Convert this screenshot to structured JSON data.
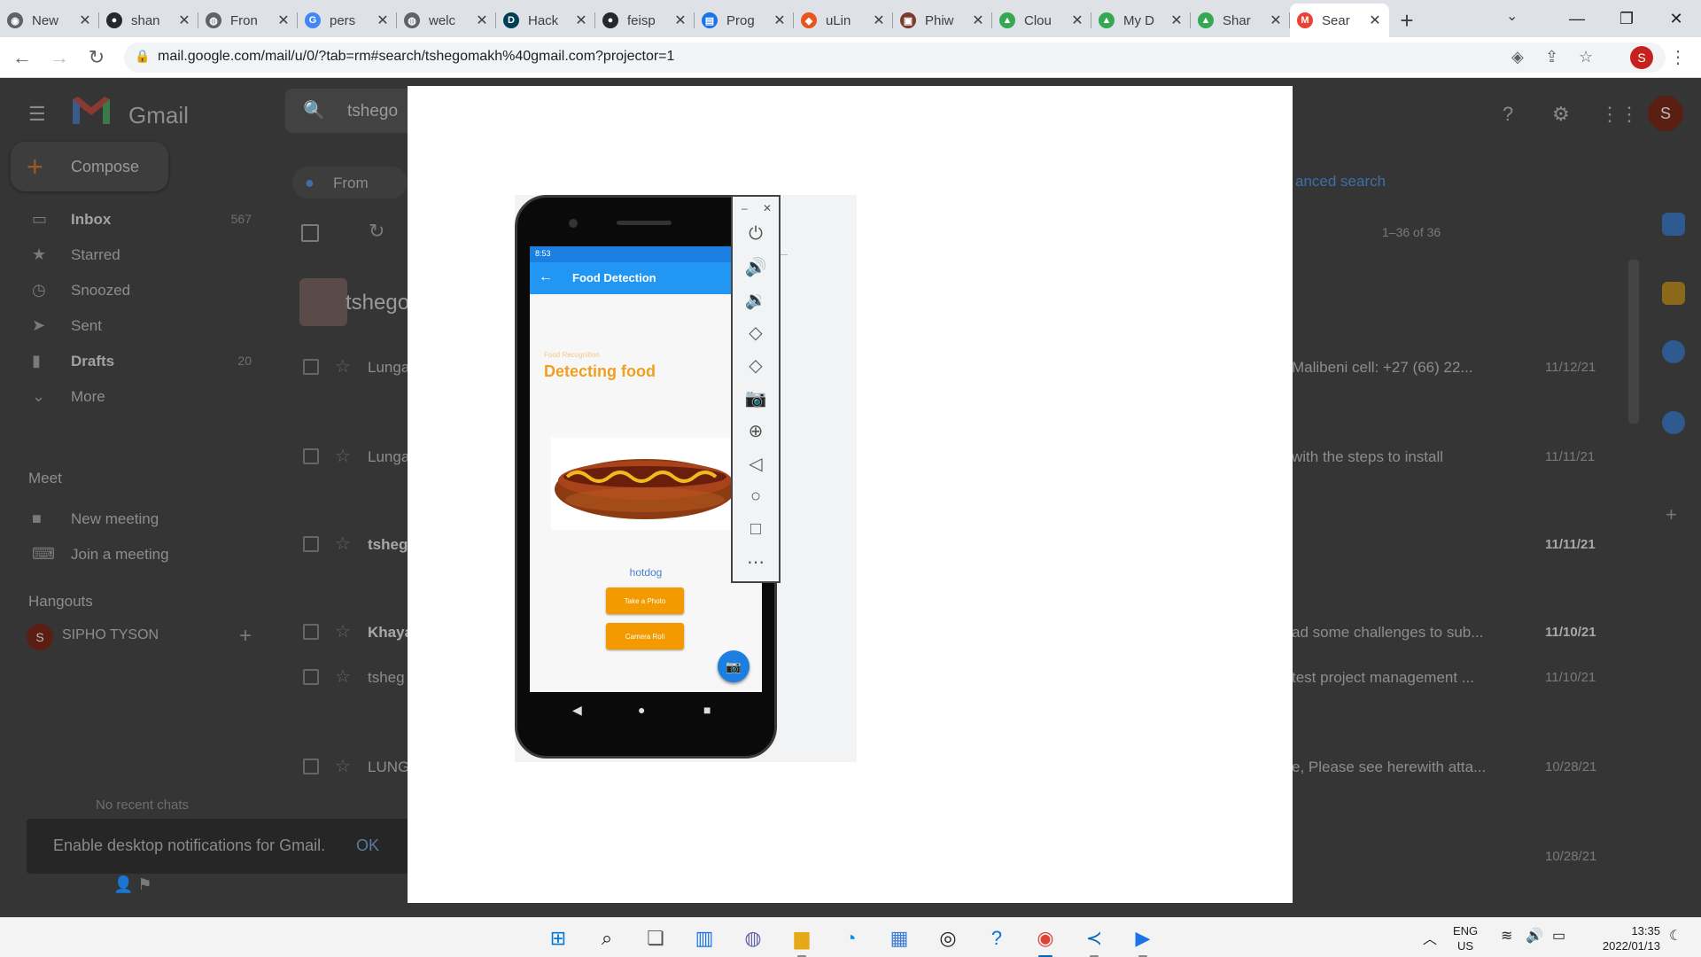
{
  "browser": {
    "tabs": [
      {
        "label": "New",
        "favicon": "chrome-icon",
        "color": "#5f6368"
      },
      {
        "label": "shan",
        "favicon": "github-icon",
        "color": "#24292e"
      },
      {
        "label": "Fron",
        "favicon": "globe-icon",
        "color": "#5f6368"
      },
      {
        "label": "pers",
        "favicon": "google-icon",
        "color": "#4285f4"
      },
      {
        "label": "welc",
        "favicon": "globe-icon",
        "color": "#5f6368"
      },
      {
        "label": "Hack",
        "favicon": "devpost-icon",
        "color": "#003e54"
      },
      {
        "label": "feisp",
        "favicon": "github-icon",
        "color": "#24292e"
      },
      {
        "label": "Prog",
        "favicon": "docs-icon",
        "color": "#1a73e8"
      },
      {
        "label": "uLin",
        "favicon": "ulink-icon",
        "color": "#e8541c"
      },
      {
        "label": "Phiw",
        "favicon": "photo-icon",
        "color": "#7a3b2e"
      },
      {
        "label": "Clou",
        "favicon": "drive-icon",
        "color": "#34a853"
      },
      {
        "label": "My D",
        "favicon": "drive-icon",
        "color": "#34a853"
      },
      {
        "label": "Shar",
        "favicon": "drive-icon",
        "color": "#34a853"
      },
      {
        "label": "Sear",
        "favicon": "gmail-icon",
        "color": "#ea4335",
        "active": true
      }
    ],
    "url": "mail.google.com/mail/u/0/?tab=rm#search/tshegomakh%40gmail.com?projector=1",
    "profile_initial": "S"
  },
  "gmail": {
    "logo_text": "Gmail",
    "search_value": "tshego",
    "compose": "Compose",
    "nav": [
      {
        "label": "Inbox",
        "count": "567",
        "icon": "inbox-icon",
        "bold": true
      },
      {
        "label": "Starred",
        "count": "",
        "icon": "star-icon",
        "bold": false
      },
      {
        "label": "Snoozed",
        "count": "",
        "icon": "clock-icon",
        "bold": false
      },
      {
        "label": "Sent",
        "count": "",
        "icon": "send-icon",
        "bold": false
      },
      {
        "label": "Drafts",
        "count": "20",
        "icon": "draft-icon",
        "bold": true
      },
      {
        "label": "More",
        "count": "",
        "icon": "chevron-down-icon",
        "bold": false
      }
    ],
    "meet_heading": "Meet",
    "meet_items": [
      {
        "label": "New meeting",
        "icon": "video-icon"
      },
      {
        "label": "Join a meeting",
        "icon": "keyboard-icon"
      }
    ],
    "hangouts_heading": "Hangouts",
    "hangouts_user": "SIPHO TYSON",
    "hangouts_initial": "S",
    "no_recent": "No recent chats",
    "notification": "Enable desktop notifications for Gmail.",
    "notification_ok": "OK",
    "filter_from": "From",
    "advanced_search": "anced search",
    "pager": "1–36 of 36",
    "group_name": "tshego",
    "avatar_initial": "S",
    "rows": [
      {
        "from": "Lunga",
        "snippet": "Malibeni cell: +27 (66) 22...",
        "date": "11/12/21",
        "unread": false
      },
      {
        "from": "Lunga",
        "snippet": "with the steps to install",
        "date": "11/11/21",
        "unread": false
      },
      {
        "from": "tsheg",
        "snippet": "",
        "date": "11/11/21",
        "unread": true
      },
      {
        "from": "Khaya",
        "snippet": "ad some challenges to sub...",
        "date": "11/10/21",
        "unread": true
      },
      {
        "from": "tsheg",
        "snippet": "test project management ...",
        "date": "11/10/21",
        "unread": false
      },
      {
        "from": "LUNG",
        "snippet": "e, Please see herewith atta...",
        "date": "10/28/21",
        "unread": false
      },
      {
        "from": "",
        "snippet": "",
        "date": "10/28/21",
        "unread": false
      }
    ]
  },
  "phone_app": {
    "status_time": "8:53",
    "title": "Food Detection",
    "subtitle": "Food Recognition",
    "heading": "Detecting food",
    "result": "hotdog",
    "take_photo": "Take a Photo",
    "camera_roll": "Camera Roll",
    "accent": "#2196f3",
    "button_color": "#f29a00"
  },
  "emulator_controls": [
    "power-icon",
    "volume-up-icon",
    "volume-down-icon",
    "rotate-left-icon",
    "rotate-right-icon",
    "camera-icon",
    "zoom-icon",
    "back-icon",
    "home-icon",
    "overview-icon",
    "more-icon"
  ],
  "taskbar": {
    "apps": [
      "windows-start-icon",
      "search-icon",
      "task-view-icon",
      "widgets-icon",
      "teams-chat-icon",
      "file-explorer-icon",
      "edge-icon",
      "store-icon",
      "app-icon",
      "help-icon",
      "chrome-icon",
      "vscode-icon",
      "media-icon"
    ],
    "lang_1": "ENG",
    "lang_2": "US",
    "time": "13:35",
    "date": "2022/01/13"
  }
}
